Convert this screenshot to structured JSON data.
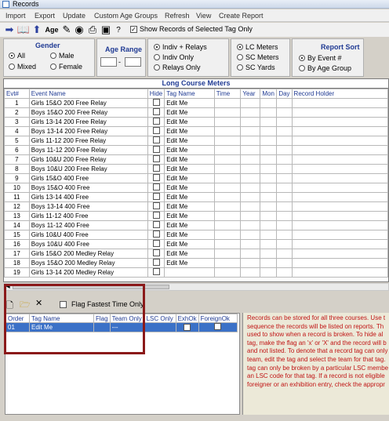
{
  "window": {
    "title": "Records"
  },
  "menu": [
    "Import",
    "Export",
    "Update",
    "Custom Age Groups",
    "Refresh",
    "View",
    "Create Report"
  ],
  "toolbar": {
    "age_label": "Age",
    "show_records_label": "Show Records of Selected Tag Only",
    "show_records_checked": true
  },
  "gender": {
    "title": "Gender",
    "options": [
      "All",
      "Male",
      "Mixed",
      "Female"
    ],
    "selected": "All"
  },
  "age_range": {
    "title": "Age Range",
    "from": "",
    "to": "",
    "separator": "-"
  },
  "entry_type": {
    "options": [
      "Indiv + Relays",
      "Indiv Only",
      "Relays Only"
    ],
    "selected": "Indiv + Relays"
  },
  "course": {
    "options": [
      "LC Meters",
      "SC Meters",
      "SC Yards"
    ],
    "selected": "LC Meters"
  },
  "report_sort": {
    "title": "Report Sort",
    "options": [
      "By Event #",
      "By Age Group"
    ],
    "selected": "By Event #"
  },
  "grid": {
    "title": "Long Course Meters",
    "columns": [
      "Evt#",
      "Event Name",
      "Hide",
      "Tag Name",
      "Time",
      "Year",
      "Mon",
      "Day",
      "Record Holder"
    ],
    "rows": [
      {
        "evt": "1",
        "name": "Girls 15&O 200 Free Relay",
        "tag": "Edit Me"
      },
      {
        "evt": "2",
        "name": "Boys 15&O 200 Free Relay",
        "tag": "Edit Me"
      },
      {
        "evt": "3",
        "name": "Girls 13-14 200 Free Relay",
        "tag": "Edit Me"
      },
      {
        "evt": "4",
        "name": "Boys 13-14 200 Free Relay",
        "tag": "Edit Me"
      },
      {
        "evt": "5",
        "name": "Girls 11-12 200 Free Relay",
        "tag": "Edit Me"
      },
      {
        "evt": "6",
        "name": "Boys 11-12 200 Free Relay",
        "tag": "Edit Me"
      },
      {
        "evt": "7",
        "name": "Girls 10&U 200 Free Relay",
        "tag": "Edit Me"
      },
      {
        "evt": "8",
        "name": "Boys 10&U 200 Free Relay",
        "tag": "Edit Me"
      },
      {
        "evt": "9",
        "name": "Girls 15&O 400 Free",
        "tag": "Edit Me"
      },
      {
        "evt": "10",
        "name": "Boys 15&O 400 Free",
        "tag": "Edit Me"
      },
      {
        "evt": "11",
        "name": "Girls 13-14 400 Free",
        "tag": "Edit Me"
      },
      {
        "evt": "12",
        "name": "Boys 13-14 400 Free",
        "tag": "Edit Me"
      },
      {
        "evt": "13",
        "name": "Girls 11-12 400 Free",
        "tag": "Edit Me"
      },
      {
        "evt": "14",
        "name": "Boys 11-12 400 Free",
        "tag": "Edit Me"
      },
      {
        "evt": "15",
        "name": "Girls 10&U 400 Free",
        "tag": "Edit Me"
      },
      {
        "evt": "16",
        "name": "Boys 10&U 400 Free",
        "tag": "Edit Me"
      },
      {
        "evt": "17",
        "name": "Girls 15&O 200 Medley Relay",
        "tag": "Edit Me"
      },
      {
        "evt": "18",
        "name": "Boys 15&O 200 Medley Relay",
        "tag": "Edit Me"
      },
      {
        "evt": "19",
        "name": "Girls 13-14 200 Medley Relay",
        "tag": ""
      }
    ]
  },
  "lower": {
    "flag_fastest_label": "Flag Fastest Time Only",
    "flag_fastest_checked": false,
    "columns": [
      "Order",
      "Tag Name",
      "Flag",
      "Team Only",
      "LSC Only",
      "ExhOk",
      "ForeignOk"
    ],
    "rows": [
      {
        "order": "01",
        "tag": "Edit Me",
        "flag": "",
        "team": "---",
        "lsc": "",
        "exh": true,
        "foreign": false
      }
    ]
  },
  "info_lines": [
    "Records can be stored for all three courses. Use t",
    "sequence the records will be listed on reports. Th",
    "used to show when a record is broken. To hide al",
    "tag, make the flag an 'x' or 'X' and the record will b",
    "and not listed. To denote that a record tag can only",
    "team, edit the tag and select the team for that tag.",
    "tag can only be broken by a particular LSC membe",
    "an LSC code for that tag. If a record is not eligible",
    "foreigner or an exhibition entry, check the appropr"
  ]
}
